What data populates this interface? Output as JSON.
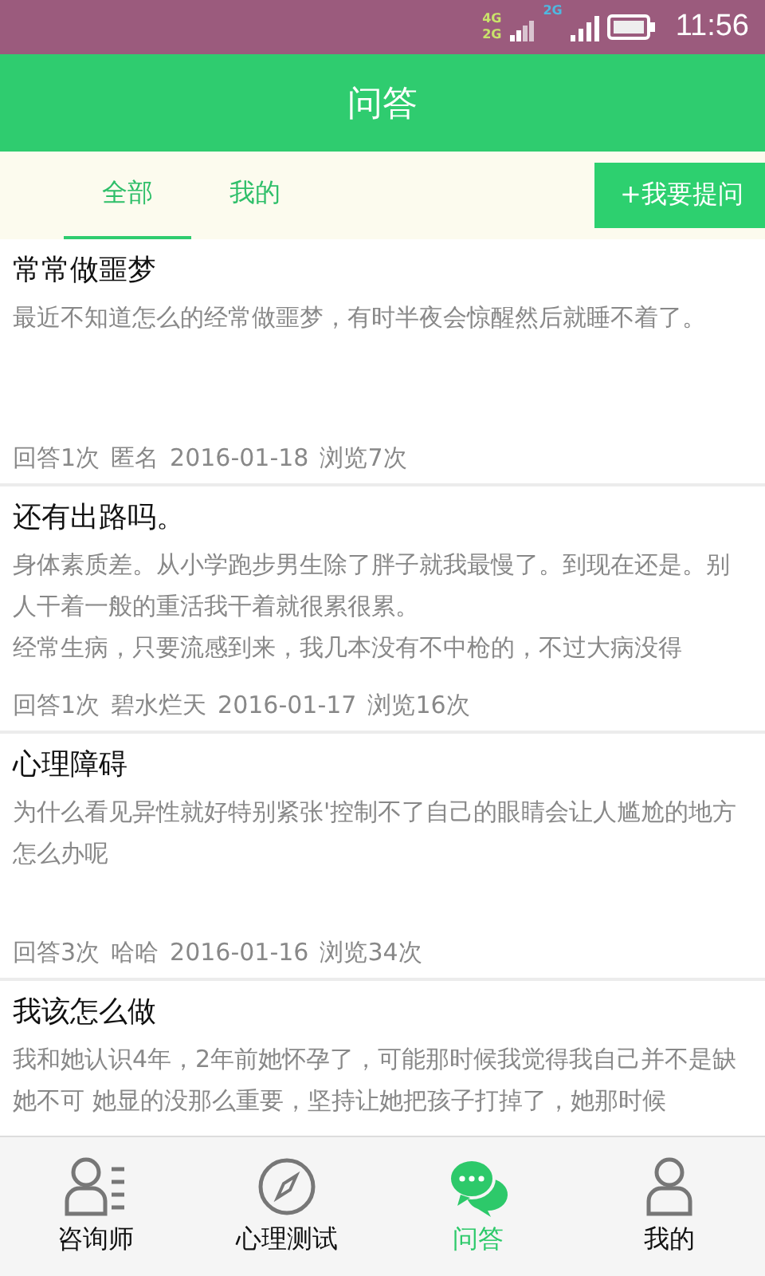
{
  "status_bar": {
    "network_labels": [
      "4G",
      "2G",
      "2G"
    ],
    "time": "11:56"
  },
  "header": {
    "title": "问答"
  },
  "tabs": [
    {
      "label": "全部",
      "selected": true
    },
    {
      "label": "我的",
      "selected": false
    }
  ],
  "ask_button": {
    "label": "+我要提问"
  },
  "questions": [
    {
      "title": "常常做噩梦",
      "body": "最近不知道怎么的经常做噩梦，有时半夜会惊醒然后就睡不着了。",
      "answers": "回答1次",
      "author": "匿名",
      "date": "2016-01-18",
      "views": "浏览7次"
    },
    {
      "title": "还有出路吗。",
      "body": "身体素质差。从小学跑步男生除了胖子就我最慢了。到现在还是。别人干着一般的重活我干着就很累很累。",
      "body_2": "经常生病，只要流感到来，我几本没有不中枪的，不过大病没得",
      "answers": "回答1次",
      "author": "碧水烂天",
      "date": "2016-01-17",
      "views": "浏览16次"
    },
    {
      "title": "心理障碍",
      "body": "为什么看见异性就好特别紧张'控制不了自己的眼睛会让人尴尬的地方怎么办呢",
      "answers": "回答3次",
      "author": "哈哈",
      "date": "2016-01-16",
      "views": "浏览34次"
    },
    {
      "title": "我该怎么做",
      "body": "我和她认识4年，2年前她怀孕了，可能那时候我觉得我自己并不是缺她不可 她显的没那么重要，坚持让她把孩子打掉了，她那时候"
    }
  ],
  "nav": [
    {
      "kind": "counselor",
      "label": "咨询师",
      "selected": false
    },
    {
      "kind": "test",
      "label": "心理测试",
      "selected": false
    },
    {
      "kind": "qa",
      "label": "问答",
      "selected": true
    },
    {
      "kind": "me",
      "label": "我的",
      "selected": false
    }
  ]
}
